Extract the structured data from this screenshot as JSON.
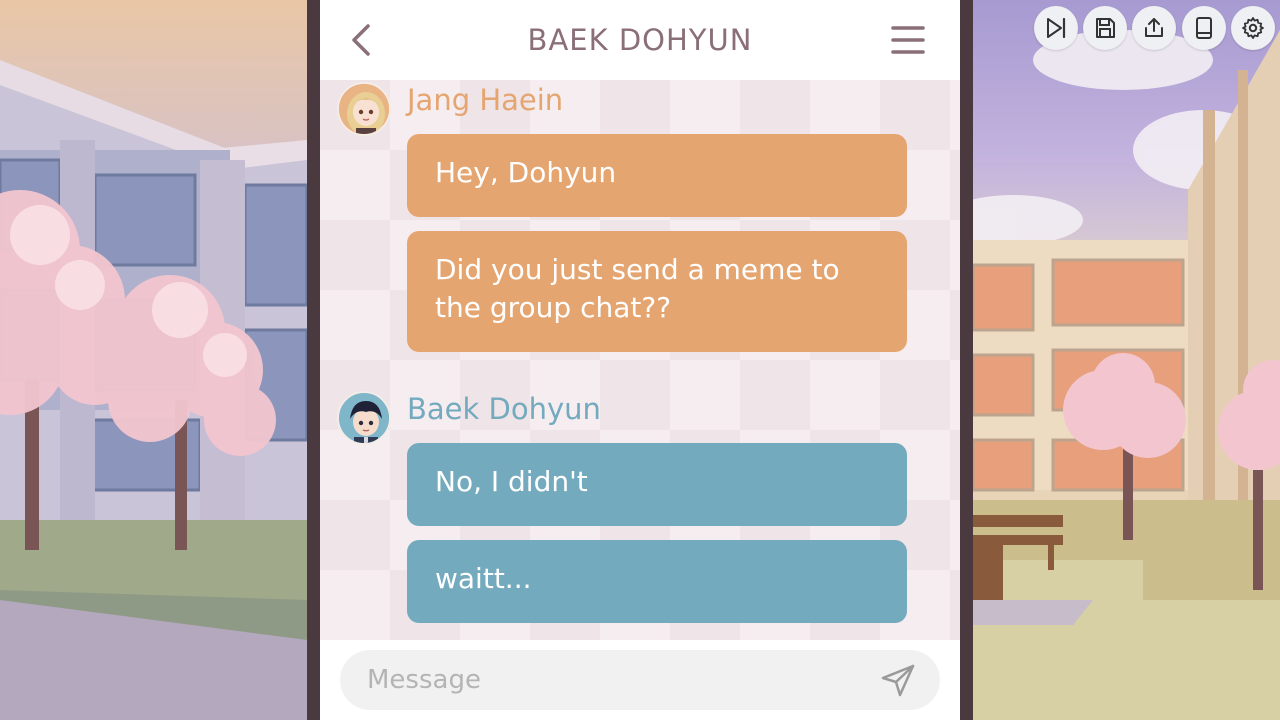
{
  "header": {
    "title": "BAEK DOHYUN"
  },
  "messages": [
    {
      "sender": "Jang Haein",
      "sender_color": "#e5a570",
      "bubble_color": "#e5a570",
      "lines": [
        "Hey, Dohyun",
        "Did you just send a meme to the group chat??"
      ]
    },
    {
      "sender": "Baek Dohyun",
      "sender_color": "#74aabe",
      "bubble_color": "#74aabe",
      "lines": [
        "No, I didn't",
        "waitt..."
      ]
    }
  ],
  "composer": {
    "placeholder": "Message"
  },
  "toolbar": {
    "buttons": [
      "skip-icon",
      "save-icon",
      "share-icon",
      "log-icon",
      "settings-icon"
    ]
  },
  "colors": {
    "frame": "#4a393f",
    "header_text": "#8a6f78",
    "chat_bg": "#efe4e7"
  }
}
